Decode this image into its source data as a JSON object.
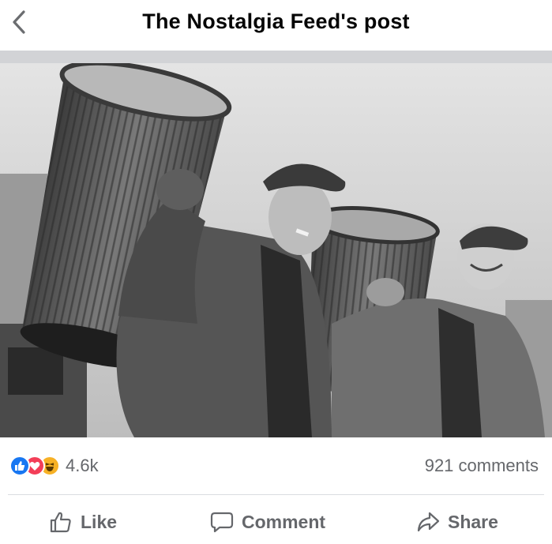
{
  "header": {
    "title": "The Nostalgia Feed's post",
    "back_icon": "chevron-left-icon"
  },
  "photo": {
    "style": "black-and-white photograph"
  },
  "reactions": {
    "icons": [
      "like-reaction-icon",
      "love-reaction-icon",
      "haha-reaction-icon"
    ],
    "count": "4.6k"
  },
  "comments": {
    "count_label": "921 comments"
  },
  "actions": {
    "like_label": "Like",
    "comment_label": "Comment",
    "share_label": "Share"
  },
  "colors": {
    "like_blue": "#1877f2",
    "love_red": "#f33e58",
    "haha_yellow": "#f7b125",
    "secondary_text": "#65676b",
    "header_bar": "#d2d3d6"
  }
}
